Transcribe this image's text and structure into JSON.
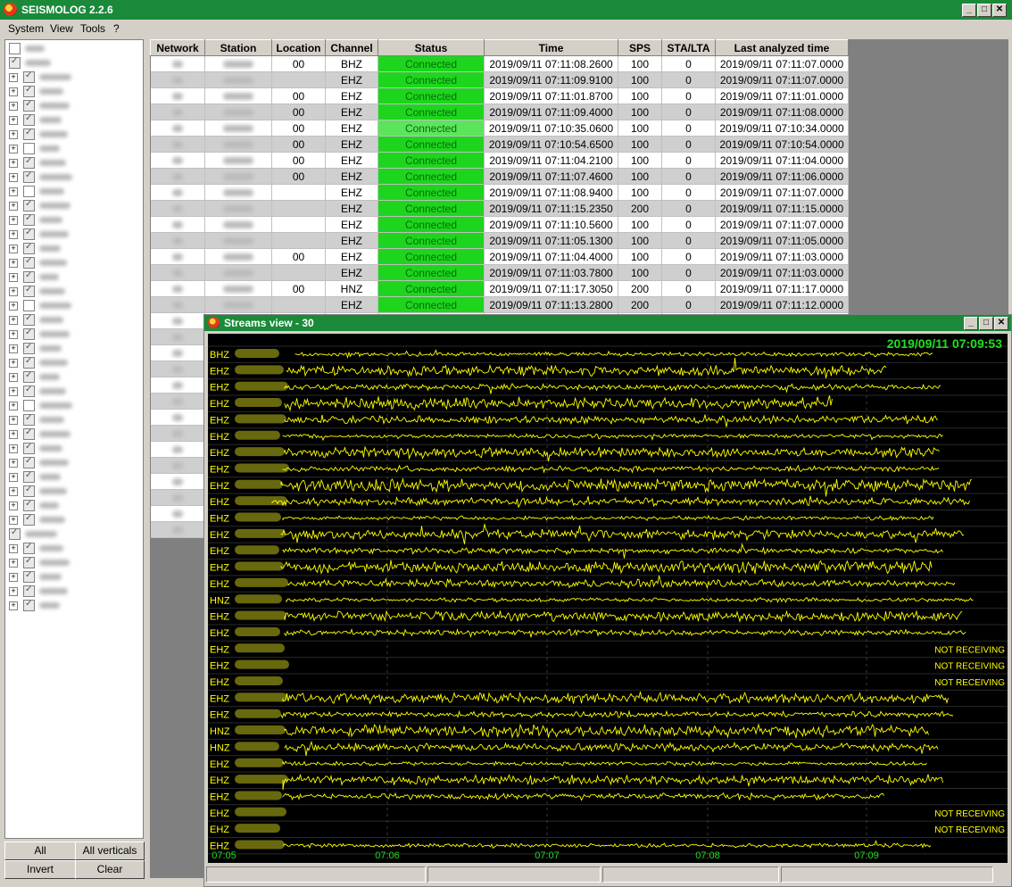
{
  "app": {
    "title": "SEISMOLOG 2.2.6"
  },
  "menu": [
    "System",
    "View",
    "Tools",
    "?"
  ],
  "tree_buttons": {
    "all": "All",
    "all_verticals": "All verticals",
    "invert": "Invert",
    "clear": "Clear"
  },
  "table": {
    "headers": [
      "Network",
      "Station",
      "Location",
      "Channel",
      "Status",
      "Time",
      "SPS",
      "STA/LTA",
      "Last analyzed time"
    ],
    "rows": [
      {
        "location": "00",
        "channel": "BHZ",
        "status": "Connected",
        "time": "2019/09/11 07:11:08.2600",
        "sps": "100",
        "stalta": "0",
        "last": "2019/09/11 07:11:07.0000"
      },
      {
        "location": "",
        "channel": "EHZ",
        "status": "Connected",
        "time": "2019/09/11 07:11:09.9100",
        "sps": "100",
        "stalta": "0",
        "last": "2019/09/11 07:11:07.0000"
      },
      {
        "location": "00",
        "channel": "EHZ",
        "status": "Connected",
        "time": "2019/09/11 07:11:01.8700",
        "sps": "100",
        "stalta": "0",
        "last": "2019/09/11 07:11:01.0000"
      },
      {
        "location": "00",
        "channel": "EHZ",
        "status": "Connected",
        "time": "2019/09/11 07:11:09.4000",
        "sps": "100",
        "stalta": "0",
        "last": "2019/09/11 07:11:08.0000"
      },
      {
        "location": "00",
        "channel": "EHZ",
        "status": "Connected",
        "time": "2019/09/11 07:10:35.0600",
        "sps": "100",
        "stalta": "0",
        "last": "2019/09/11 07:10:34.0000"
      },
      {
        "location": "00",
        "channel": "EHZ",
        "status": "Connected",
        "time": "2019/09/11 07:10:54.6500",
        "sps": "100",
        "stalta": "0",
        "last": "2019/09/11 07:10:54.0000"
      },
      {
        "location": "00",
        "channel": "EHZ",
        "status": "Connected",
        "time": "2019/09/11 07:11:04.2100",
        "sps": "100",
        "stalta": "0",
        "last": "2019/09/11 07:11:04.0000"
      },
      {
        "location": "00",
        "channel": "EHZ",
        "status": "Connected",
        "time": "2019/09/11 07:11:07.4600",
        "sps": "100",
        "stalta": "0",
        "last": "2019/09/11 07:11:06.0000"
      },
      {
        "location": "",
        "channel": "EHZ",
        "status": "Connected",
        "time": "2019/09/11 07:11:08.9400",
        "sps": "100",
        "stalta": "0",
        "last": "2019/09/11 07:11:07.0000"
      },
      {
        "location": "",
        "channel": "EHZ",
        "status": "Connected",
        "time": "2019/09/11 07:11:15.2350",
        "sps": "200",
        "stalta": "0",
        "last": "2019/09/11 07:11:15.0000"
      },
      {
        "location": "",
        "channel": "EHZ",
        "status": "Connected",
        "time": "2019/09/11 07:11:10.5600",
        "sps": "100",
        "stalta": "0",
        "last": "2019/09/11 07:11:07.0000"
      },
      {
        "location": "",
        "channel": "EHZ",
        "status": "Connected",
        "time": "2019/09/11 07:11:05.1300",
        "sps": "100",
        "stalta": "0",
        "last": "2019/09/11 07:11:05.0000"
      },
      {
        "location": "00",
        "channel": "EHZ",
        "status": "Connected",
        "time": "2019/09/11 07:11:04.4000",
        "sps": "100",
        "stalta": "0",
        "last": "2019/09/11 07:11:03.0000"
      },
      {
        "location": "",
        "channel": "EHZ",
        "status": "Connected",
        "time": "2019/09/11 07:11:03.7800",
        "sps": "100",
        "stalta": "0",
        "last": "2019/09/11 07:11:03.0000"
      },
      {
        "location": "00",
        "channel": "HNZ",
        "status": "Connected",
        "time": "2019/09/11 07:11:17.3050",
        "sps": "200",
        "stalta": "0",
        "last": "2019/09/11 07:11:17.0000"
      },
      {
        "location": "",
        "channel": "EHZ",
        "status": "Connected",
        "time": "2019/09/11 07:11:13.2800",
        "sps": "200",
        "stalta": "0",
        "last": "2019/09/11 07:11:12.0000"
      }
    ]
  },
  "streams": {
    "title": "Streams view - 30",
    "timestamp": "2019/09/11 07:09:53",
    "x_ticks": [
      "07:05",
      "07:06",
      "07:07",
      "07:08",
      "07:09"
    ],
    "not_receiving": "NOT RECEIVING",
    "channels": [
      {
        "ch": "BHZ",
        "receiving": true
      },
      {
        "ch": "EHZ",
        "receiving": true
      },
      {
        "ch": "EHZ",
        "receiving": true
      },
      {
        "ch": "EHZ",
        "receiving": true
      },
      {
        "ch": "EHZ",
        "receiving": true
      },
      {
        "ch": "EHZ",
        "receiving": true
      },
      {
        "ch": "EHZ",
        "receiving": true
      },
      {
        "ch": "EHZ",
        "receiving": true
      },
      {
        "ch": "EHZ",
        "receiving": true
      },
      {
        "ch": "EHZ",
        "receiving": true
      },
      {
        "ch": "EHZ",
        "receiving": true
      },
      {
        "ch": "EHZ",
        "receiving": true
      },
      {
        "ch": "EHZ",
        "receiving": true
      },
      {
        "ch": "EHZ",
        "receiving": true
      },
      {
        "ch": "EHZ",
        "receiving": true
      },
      {
        "ch": "HNZ",
        "receiving": true
      },
      {
        "ch": "EHZ",
        "receiving": true
      },
      {
        "ch": "EHZ",
        "receiving": true
      },
      {
        "ch": "EHZ",
        "receiving": false
      },
      {
        "ch": "EHZ",
        "receiving": false
      },
      {
        "ch": "EHZ",
        "receiving": false
      },
      {
        "ch": "EHZ",
        "receiving": true
      },
      {
        "ch": "EHZ",
        "receiving": true
      },
      {
        "ch": "HNZ",
        "receiving": true
      },
      {
        "ch": "HNZ",
        "receiving": true
      },
      {
        "ch": "EHZ",
        "receiving": true
      },
      {
        "ch": "EHZ",
        "receiving": true
      },
      {
        "ch": "EHZ",
        "receiving": true
      },
      {
        "ch": "EHZ",
        "receiving": false
      },
      {
        "ch": "EHZ",
        "receiving": false
      },
      {
        "ch": "EHZ",
        "receiving": true
      }
    ]
  }
}
